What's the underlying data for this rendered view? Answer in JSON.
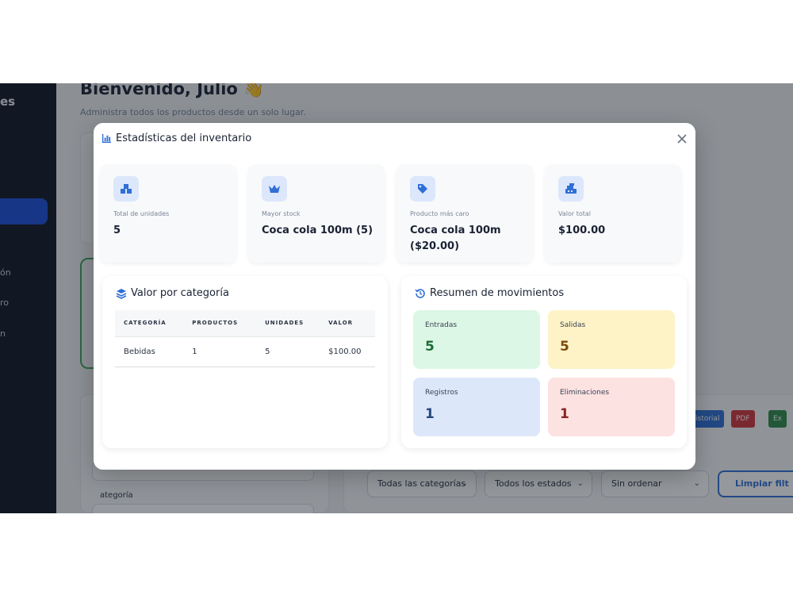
{
  "sidebar": {
    "brand": "es",
    "items": [
      "ón",
      "ro",
      "n"
    ]
  },
  "header": {
    "greeting": "Bienvenido, Julio 👋",
    "subtitle": "Administra todos los productos desde un solo lugar."
  },
  "background": {
    "categoria_label": "ategoría",
    "buttons": [
      "istorial",
      "PDF",
      "Ex"
    ],
    "filters": {
      "categorias": "Todas las categorías",
      "estados": "Todos los estados",
      "orden": "Sin ordenar"
    },
    "clear_label": "Limpiar filt"
  },
  "modal": {
    "title": "Estadísticas del inventario",
    "stats": [
      {
        "icon": "boxes-icon",
        "label": "Total de unidades",
        "value": "5"
      },
      {
        "icon": "crown-icon",
        "label": "Mayor stock",
        "value": "Coca cola 100m (5)"
      },
      {
        "icon": "tag-icon",
        "label": "Producto más caro",
        "value": "Coca cola 100m ($20.00)"
      },
      {
        "icon": "cash-register-icon",
        "label": "Valor total",
        "value": "$100.00"
      }
    ],
    "category_panel": {
      "title": "Valor por categoría",
      "columns": [
        "CATEGORÍA",
        "PRODUCTOS",
        "UNIDADES",
        "VALOR"
      ],
      "rows": [
        [
          "Bebidas",
          "1",
          "5",
          "$100.00"
        ]
      ]
    },
    "movements_panel": {
      "title": "Resumen de movimientos",
      "cards": [
        {
          "label": "Entradas",
          "value": "5"
        },
        {
          "label": "Salidas",
          "value": "5"
        },
        {
          "label": "Registros",
          "value": "1"
        },
        {
          "label": "Eliminaciones",
          "value": "1"
        }
      ]
    }
  },
  "colors": {
    "accent": "#2f6fd6",
    "sidebar_bg": "#0f1624",
    "entradas_bg": "#dcf7e5",
    "entradas_text": "#1f6b3a",
    "salidas_bg": "#fef3c7",
    "salidas_text": "#7a4a0a",
    "registros_bg": "#dce8f9",
    "registros_text": "#27487e",
    "eliminaciones_bg": "#fde2e2",
    "eliminaciones_text": "#8a2424"
  }
}
